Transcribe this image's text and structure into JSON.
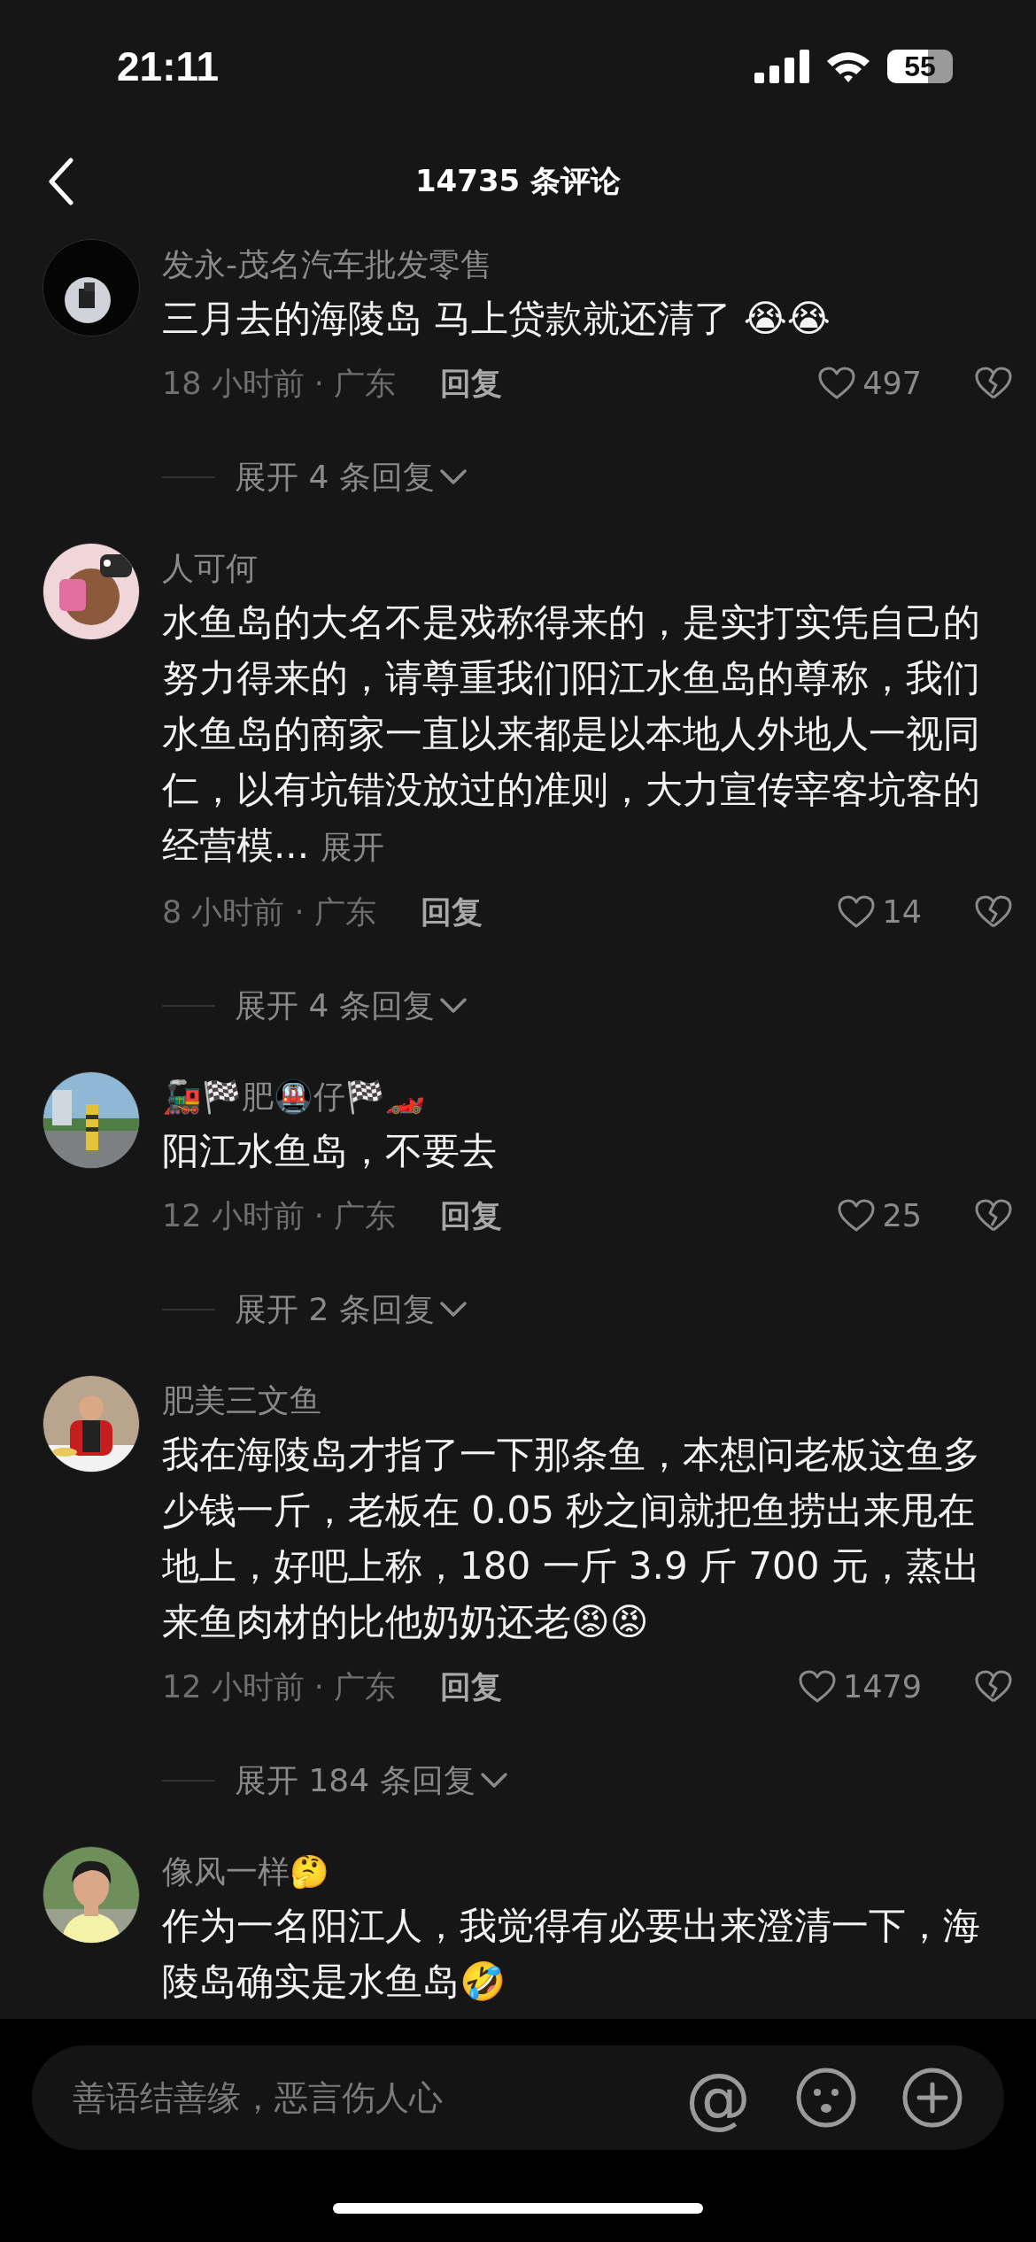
{
  "status_bar": {
    "time": "21:11",
    "battery": "55"
  },
  "header": {
    "title": "14735 条评论"
  },
  "comments": [
    {
      "user": "发永-茂名汽车批发零售",
      "text": "三月去的海陵岛 马上贷款就还清了 😭😭",
      "meta": "18 小时前 · 广东",
      "reply": "回复",
      "likes": "497",
      "replies": "展开 4 条回复"
    },
    {
      "user": "人可何",
      "text": "水鱼岛的大名不是戏称得来的，是实打实凭自己的努力得来的，请尊重我们阳江水鱼岛的尊称，我们水鱼岛的商家一直以来都是以本地人外地人一视同仁，以有坑错没放过的准则，大力宣传宰客坑客的经营模...",
      "more": "展开",
      "meta": "8 小时前 · 广东",
      "reply": "回复",
      "likes": "14",
      "replies": "展开 4 条回复"
    },
    {
      "user": "🚂🏁肥🚇仔🏁🏎️",
      "text": "阳江水鱼岛，不要去",
      "meta": "12 小时前 · 广东",
      "reply": "回复",
      "likes": "25",
      "replies": "展开 2 条回复"
    },
    {
      "user": "肥美三文鱼",
      "text": "我在海陵岛才指了一下那条鱼，本想问老板这鱼多少钱一斤，老板在 0.05 秒之间就把鱼捞出来甩在地上，好吧上称，180 一斤 3.9 斤 700 元，蒸出来鱼肉材的比他奶奶还老😡😡",
      "meta": "12 小时前 · 广东",
      "reply": "回复",
      "likes": "1479",
      "replies": "展开 184 条回复"
    },
    {
      "user": "像风一样🤔",
      "text": "作为一名阳江人，我觉得有必要出来澄清一下，海陵岛确实是水鱼岛🤣"
    }
  ],
  "composer": {
    "placeholder": "善语结善缘，恶言伤人心",
    "mention": "@"
  }
}
